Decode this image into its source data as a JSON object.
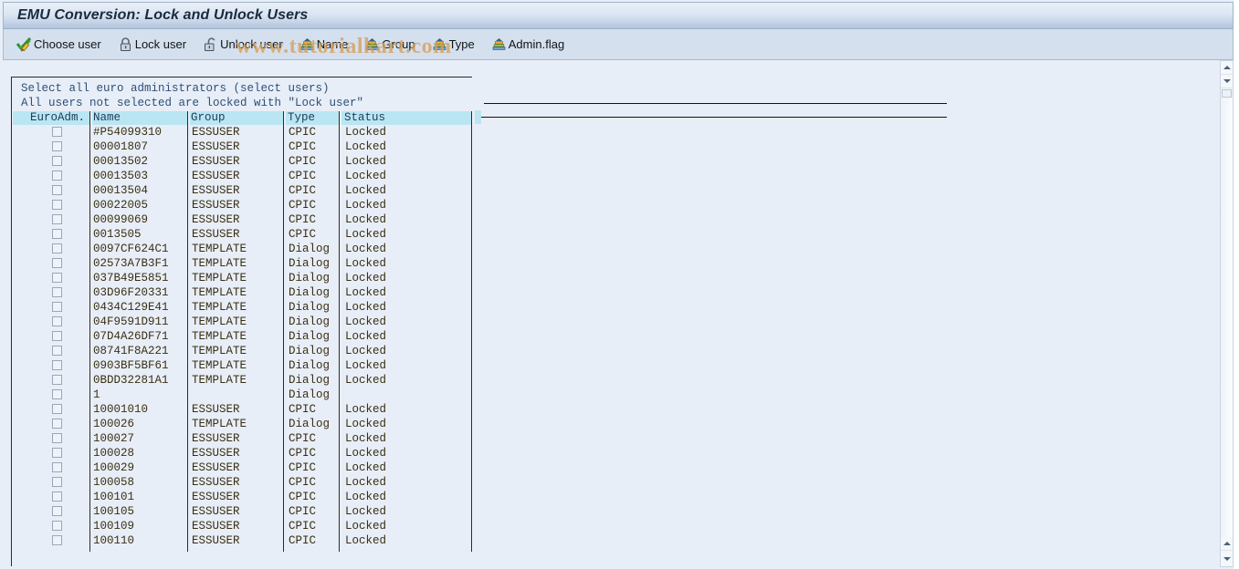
{
  "window": {
    "title": "EMU Conversion: Lock and Unlock Users"
  },
  "watermark": {
    "text": "www.tutorialkart.com",
    "color": "#d5a05c"
  },
  "toolbar": {
    "buttons": [
      {
        "label": "Choose user",
        "icon": "check-pencil-icon"
      },
      {
        "label": "Lock user",
        "icon": "lock-closed-icon"
      },
      {
        "label": "Unlock user",
        "icon": "lock-open-icon"
      },
      {
        "label": "Name",
        "icon": "sort-ascending-icon"
      },
      {
        "label": "Group",
        "icon": "sort-ascending-icon"
      },
      {
        "label": "Type",
        "icon": "sort-ascending-icon"
      },
      {
        "label": "Admin.flag",
        "icon": "sort-ascending-icon"
      }
    ]
  },
  "panel": {
    "hint_line_1": "Select all euro administrators (select users)",
    "hint_line_2": "All users not selected are locked with \"Lock user\"",
    "table": {
      "columns": [
        "EuroAdm.",
        "Name",
        "Group",
        "Type",
        "Status"
      ],
      "rows": [
        {
          "checked": false,
          "name": "#P54099310",
          "group": "ESSUSER",
          "type": "CPIC",
          "status": "Locked"
        },
        {
          "checked": false,
          "name": "00001807",
          "group": "ESSUSER",
          "type": "CPIC",
          "status": "Locked"
        },
        {
          "checked": false,
          "name": "00013502",
          "group": "ESSUSER",
          "type": "CPIC",
          "status": "Locked"
        },
        {
          "checked": false,
          "name": "00013503",
          "group": "ESSUSER",
          "type": "CPIC",
          "status": "Locked"
        },
        {
          "checked": false,
          "name": "00013504",
          "group": "ESSUSER",
          "type": "CPIC",
          "status": "Locked"
        },
        {
          "checked": false,
          "name": "00022005",
          "group": "ESSUSER",
          "type": "CPIC",
          "status": "Locked"
        },
        {
          "checked": false,
          "name": "00099069",
          "group": "ESSUSER",
          "type": "CPIC",
          "status": "Locked"
        },
        {
          "checked": false,
          "name": "0013505",
          "group": "ESSUSER",
          "type": "CPIC",
          "status": "Locked"
        },
        {
          "checked": false,
          "name": "0097CF624C1",
          "group": "TEMPLATE",
          "type": "Dialog",
          "status": "Locked"
        },
        {
          "checked": false,
          "name": "02573A7B3F1",
          "group": "TEMPLATE",
          "type": "Dialog",
          "status": "Locked"
        },
        {
          "checked": false,
          "name": "037B49E5851",
          "group": "TEMPLATE",
          "type": "Dialog",
          "status": "Locked"
        },
        {
          "checked": false,
          "name": "03D96F20331",
          "group": "TEMPLATE",
          "type": "Dialog",
          "status": "Locked"
        },
        {
          "checked": false,
          "name": "0434C129E41",
          "group": "TEMPLATE",
          "type": "Dialog",
          "status": "Locked"
        },
        {
          "checked": false,
          "name": "04F9591D911",
          "group": "TEMPLATE",
          "type": "Dialog",
          "status": "Locked"
        },
        {
          "checked": false,
          "name": "07D4A26DF71",
          "group": "TEMPLATE",
          "type": "Dialog",
          "status": "Locked"
        },
        {
          "checked": false,
          "name": "08741F8A221",
          "group": "TEMPLATE",
          "type": "Dialog",
          "status": "Locked"
        },
        {
          "checked": false,
          "name": "0903BF5BF61",
          "group": "TEMPLATE",
          "type": "Dialog",
          "status": "Locked"
        },
        {
          "checked": false,
          "name": "0BDD32281A1",
          "group": "TEMPLATE",
          "type": "Dialog",
          "status": "Locked"
        },
        {
          "checked": false,
          "name": "1",
          "group": "",
          "type": "Dialog",
          "status": ""
        },
        {
          "checked": false,
          "name": "10001010",
          "group": "ESSUSER",
          "type": "CPIC",
          "status": "Locked"
        },
        {
          "checked": false,
          "name": "100026",
          "group": "TEMPLATE",
          "type": "Dialog",
          "status": "Locked"
        },
        {
          "checked": false,
          "name": "100027",
          "group": "ESSUSER",
          "type": "CPIC",
          "status": "Locked"
        },
        {
          "checked": false,
          "name": "100028",
          "group": "ESSUSER",
          "type": "CPIC",
          "status": "Locked"
        },
        {
          "checked": false,
          "name": "100029",
          "group": "ESSUSER",
          "type": "CPIC",
          "status": "Locked"
        },
        {
          "checked": false,
          "name": "100058",
          "group": "ESSUSER",
          "type": "CPIC",
          "status": "Locked"
        },
        {
          "checked": false,
          "name": "100101",
          "group": "ESSUSER",
          "type": "CPIC",
          "status": "Locked"
        },
        {
          "checked": false,
          "name": "100105",
          "group": "ESSUSER",
          "type": "CPIC",
          "status": "Locked"
        },
        {
          "checked": false,
          "name": "100109",
          "group": "ESSUSER",
          "type": "CPIC",
          "status": "Locked"
        },
        {
          "checked": false,
          "name": "100110",
          "group": "ESSUSER",
          "type": "CPIC",
          "status": "Locked"
        }
      ]
    }
  }
}
